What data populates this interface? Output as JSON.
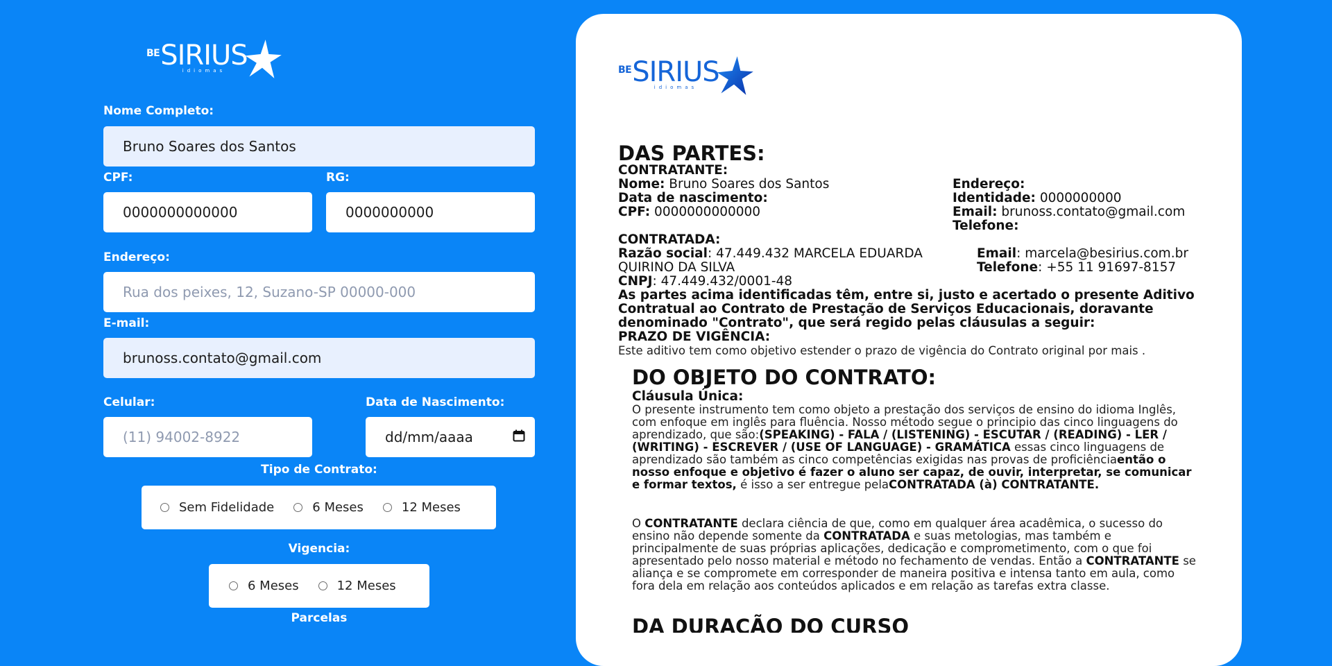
{
  "brand": {
    "be": "BE",
    "name": "SIRIUS",
    "sub": "idiomas"
  },
  "form": {
    "nome": {
      "label": "Nome Completo:",
      "value": "Bruno Soares dos Santos"
    },
    "cpf": {
      "label": "CPF:",
      "value": "0000000000000"
    },
    "rg": {
      "label": "RG:",
      "value": "0000000000"
    },
    "endereco": {
      "label": "Endereço:",
      "placeholder": "Rua dos peixes, 12, Suzano-SP 00000-000"
    },
    "email": {
      "label": "E-mail:",
      "value": "brunoss.contato@gmail.com"
    },
    "celular": {
      "label": "Celular:",
      "placeholder": "(11) 94002-8922"
    },
    "nascimento": {
      "label": "Data de Nascimento:",
      "value": "dd/mm/aaaa"
    },
    "tipo_contrato": {
      "label": "Tipo de Contrato:",
      "options": [
        "Sem Fidelidade",
        "6 Meses",
        "12 Meses"
      ]
    },
    "vigencia": {
      "label": "Vigencia:",
      "options": [
        "6 Meses",
        "12 Meses"
      ]
    },
    "parcelas": {
      "label": "Parcelas"
    }
  },
  "document": {
    "partes_title": "DAS PARTES:",
    "contratante_label": "CONTRATANTE:",
    "nome_label": "Nome:",
    "nome_value": " Bruno Soares dos Santos",
    "nasc_label": "Data de nascimento:",
    "cpf_label": "CPF:",
    "cpf_value": " 0000000000000",
    "endereco_label": "Endereço:",
    "identidade_label": "Identidade:",
    "identidade_value": " 0000000000",
    "email_label": "Email:",
    "email_value": " brunoss.contato@gmail.com",
    "telefone_label": "Telefone:",
    "contratada_label": "CONTRATADA:",
    "razao_label": "Razão social",
    "razao_value_1": ": 47.449.432 MARCELA EDUARDA",
    "razao_value_2": "QUIRINO DA SILVA",
    "cnpj_label": "CNPJ",
    "cnpj_value": ": 47.449.432/0001-48",
    "contratada_email_label": "Email",
    "contratada_email_value": ": marcela@besirius.com.br",
    "contratada_tel_label": "Telefone",
    "contratada_tel_value": ": +55 11 91697-8157",
    "intro_1": "As partes acima identificadas têm, entre si, justo e acertado o presente Aditivo",
    "intro_2": "Contratual ao Contrato de Prestação de Serviços Educacionais, doravante",
    "intro_3": "denominado \"Contrato\", que será regido pelas cláusulas a seguir:",
    "prazo_title": "PRAZO DE VIGÊNCIA:",
    "prazo_text": "Este aditivo tem como objetivo estender o prazo de vigência do Contrato original por mais .",
    "objeto_title": "DO OBJETO DO CONTRATO:",
    "clausula_title": "Cláusula Única:",
    "obj_p1_a": "O presente instrumento tem como objeto a prestação dos serviços de ensino do idioma Inglês, com enfoque em inglês para fluência. Nosso método segue o principio das cinco linguagens do aprendizado, que são:",
    "obj_p1_b": "(SPEAKING) - FALA / (LISTENING) - ESCUTAR / (READING) - LER / (WRITING) - ESCREVER / (USE OF LANGUAGE) - GRAMÁTICA",
    "obj_p1_c": " essas cinco linguagens de aprendizado são também as cinco competências exigidas nas provas de proficiência",
    "obj_p1_d": "então o nosso enfoque e objetivo é fazer o aluno ser capaz, de ouvir, interpretar, se comunicar e formar textos,",
    "obj_p1_e": " é isso a ser entregue pela",
    "obj_p1_f": "CONTRATADA (à) CONTRATANTE.",
    "obj_p2_a": "O ",
    "obj_p2_b": "CONTRATANTE",
    "obj_p2_c": " declara ciência de que, como em qualquer área acadêmica, o sucesso do ensino não depende somente da ",
    "obj_p2_d": "CONTRATADA",
    "obj_p2_e": " e suas metologias, mas também e principalmente de suas próprias aplicações, dedicação e comprometimento, com o que foi apresentado pelo nosso material e método no fechamento de vendas. Então a ",
    "obj_p2_f": "CONTRATANTE",
    "obj_p2_g": " se aliança e se compromete em corresponder de maneira positiva e intensa tanto em aula, como fora dela em relação aos conteúdos aplicados e em relação as tarefas extra classe.",
    "duracao_title": "DA DURAÇÃO DO CURSO"
  },
  "colors": {
    "background": "#0a85f7",
    "field_filled": "#e8f0fe",
    "brand_blue": "#1565d8"
  }
}
